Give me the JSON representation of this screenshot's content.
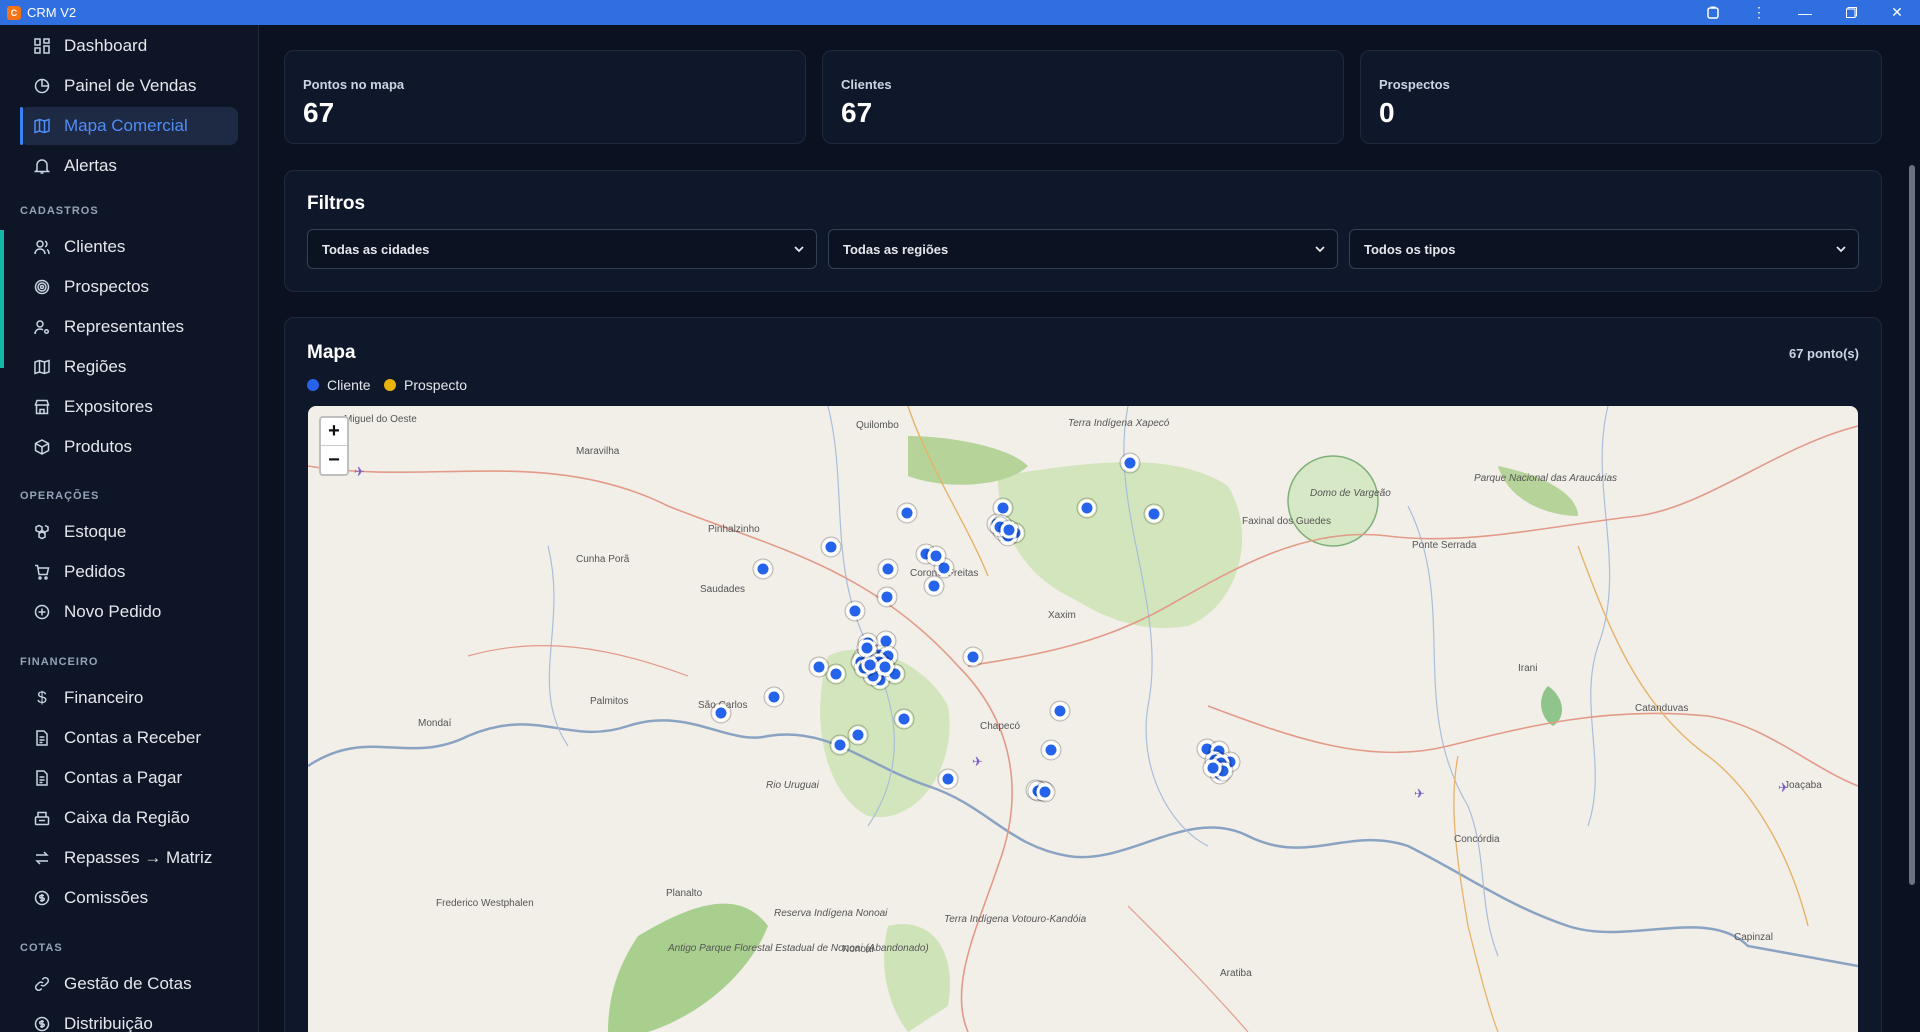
{
  "window": {
    "title": "CRM V2",
    "icon": "app-logo-icon",
    "controls": [
      "extension-icon",
      "menu-dots-icon",
      "minimize-icon",
      "maximize-icon",
      "close-icon"
    ]
  },
  "sidebar": {
    "top_items": [
      {
        "label": "Dashboard",
        "icon": "grid-icon"
      },
      {
        "label": "Painel de Vendas",
        "icon": "clock-chart-icon"
      },
      {
        "label": "Mapa Comercial",
        "icon": "map-icon",
        "active": true
      },
      {
        "label": "Alertas",
        "icon": "bell-icon"
      }
    ],
    "sections": [
      {
        "title": "CADASTROS",
        "items": [
          {
            "label": "Clientes",
            "icon": "users-icon"
          },
          {
            "label": "Prospectos",
            "icon": "target-icon"
          },
          {
            "label": "Representantes",
            "icon": "user-cog-icon"
          },
          {
            "label": "Regiões",
            "icon": "map-icon"
          },
          {
            "label": "Expositores",
            "icon": "store-icon"
          },
          {
            "label": "Produtos",
            "icon": "package-icon"
          }
        ]
      },
      {
        "title": "OPERAÇÕES",
        "items": [
          {
            "label": "Estoque",
            "icon": "boxes-icon"
          },
          {
            "label": "Pedidos",
            "icon": "cart-icon"
          },
          {
            "label": "Novo Pedido",
            "icon": "plus-circle-icon"
          }
        ]
      },
      {
        "title": "FINANCEIRO",
        "items": [
          {
            "label": "Financeiro",
            "icon": "dollar-icon"
          },
          {
            "label": "Contas a Receber",
            "icon": "document-icon"
          },
          {
            "label": "Contas a Pagar",
            "icon": "document-icon"
          },
          {
            "label": "Caixa da Região",
            "icon": "cash-register-icon"
          },
          {
            "label": "Repasses → Matriz",
            "icon": "transfer-icon"
          },
          {
            "label": "Comissões",
            "icon": "coin-icon"
          }
        ]
      },
      {
        "title": "COTAS",
        "items": [
          {
            "label": "Gestão de Cotas",
            "icon": "link-icon"
          },
          {
            "label": "Distribuição",
            "icon": "dollar-circle-icon"
          }
        ]
      }
    ]
  },
  "stats": [
    {
      "label": "Pontos no mapa",
      "value": "67"
    },
    {
      "label": "Clientes",
      "value": "67"
    },
    {
      "label": "Prospectos",
      "value": "0"
    }
  ],
  "filters": {
    "title": "Filtros",
    "selects": [
      {
        "value": "Todas as cidades"
      },
      {
        "value": "Todas as regiões"
      },
      {
        "value": "Todos os tipos"
      }
    ]
  },
  "map_card": {
    "title": "Mapa",
    "count": "67 ponto(s)",
    "legend": [
      {
        "label": "Cliente",
        "color": "#2563eb"
      },
      {
        "label": "Prospecto",
        "color": "#eab308"
      }
    ],
    "zoom_in": "+",
    "zoom_out": "−",
    "place_labels": [
      "Quilombo",
      "Terra Indígena Xapecó",
      "Maravilha",
      "Pinhalzinho",
      "Cunha Porã",
      "Saudades",
      "Coronel Freitas",
      "Xaxim",
      "Faxinal dos Guedes",
      "Domo de Vargeão",
      "Ponte Serrada",
      "Parque Nacional das Araucárias",
      "Irani",
      "Catanduvas",
      "Palmitos",
      "São Carlos",
      "Mondaí",
      "Chapecó",
      "Rio Uruguai",
      "Joaçaba",
      "Planalto",
      "Frederico Westphalen",
      "Nonoai",
      "Reserva Indígena Nonoai",
      "Antigo Parque Florestal Estadual de Nonoai (Abandonado)",
      "Terra Indígena Votouro-Kandóia",
      "Aratiba",
      "Concórdia",
      "Capinzal",
      "Miguel do Oeste"
    ]
  }
}
